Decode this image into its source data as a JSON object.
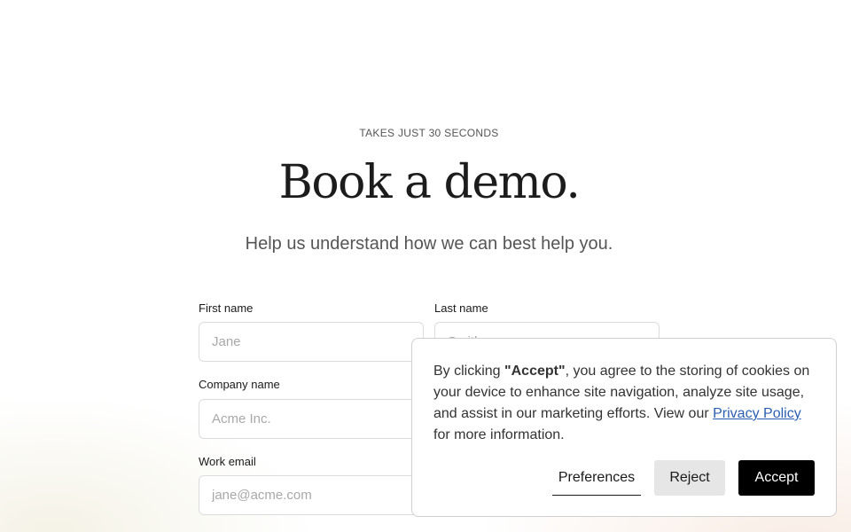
{
  "hero": {
    "eyebrow": "TAKES JUST 30 SECONDS",
    "title": "Book a demo.",
    "subtitle": "Help us understand how we can best help you."
  },
  "form": {
    "first_name": {
      "label": "First name",
      "placeholder": "Jane"
    },
    "last_name": {
      "label": "Last name",
      "placeholder": "Smith"
    },
    "company": {
      "label": "Company name",
      "placeholder": "Acme Inc."
    },
    "email": {
      "label": "Work email",
      "placeholder": "jane@acme.com"
    }
  },
  "cookie_banner": {
    "text_prefix": "By clicking ",
    "text_bold": "\"Accept\"",
    "text_middle": ", you agree to the storing of cookies on your device to enhance site navigation, analyze site usage, and assist in our marketing efforts. View our ",
    "link_text": "Privacy Policy",
    "text_suffix": " for more information.",
    "preferences_label": "Preferences",
    "reject_label": "Reject",
    "accept_label": "Accept"
  },
  "colors": {
    "accept_bg": "#000000",
    "reject_bg": "#e6e6e6",
    "link": "#2a5fb3"
  }
}
